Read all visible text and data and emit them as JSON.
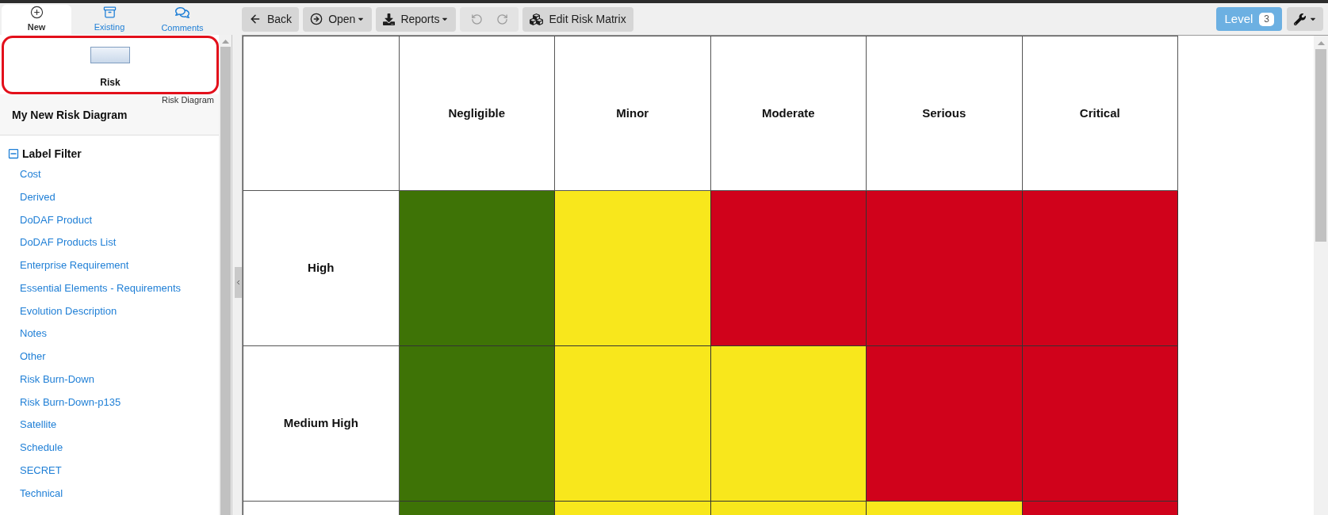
{
  "sidebar": {
    "tabs": [
      {
        "label": "New",
        "kind": "new",
        "selected": true
      },
      {
        "label": "Existing",
        "kind": "existing",
        "selected": false
      },
      {
        "label": "Comments",
        "kind": "comments",
        "selected": false
      }
    ],
    "palette": {
      "items": [
        {
          "label": "Risk",
          "selected": true
        }
      ],
      "caption": "Risk Diagram"
    },
    "diagram_name": "My New Risk Diagram",
    "label_filter": {
      "title": "Label Filter",
      "expanded": true,
      "items": [
        "Cost",
        "Derived",
        "DoDAF Product",
        "DoDAF Products List",
        "Enterprise Requirement",
        "Essential Elements - Requirements",
        "Evolution Description",
        "Notes",
        "Other",
        "Risk Burn-Down",
        "Risk Burn-Down-p135",
        "Satellite",
        "Schedule",
        "SECRET",
        "Technical"
      ]
    }
  },
  "toolbar": {
    "buttons": [
      {
        "kind": "back",
        "label": "Back",
        "dropdown": false
      },
      {
        "kind": "open",
        "label": "Open",
        "dropdown": true
      },
      {
        "kind": "reports",
        "label": "Reports",
        "dropdown": true
      },
      {
        "kind": "history",
        "items": [
          {
            "kind": "undo",
            "disabled": true
          },
          {
            "kind": "redo",
            "disabled": true
          }
        ]
      },
      {
        "kind": "matrix",
        "label": "Edit Risk Matrix",
        "dropdown": false
      }
    ],
    "level": {
      "label": "Level",
      "badge": "3"
    },
    "tools_menu": {
      "dropdown": true
    }
  },
  "matrix": {
    "columns": [
      "Negligible",
      "Minor",
      "Moderate",
      "Serious",
      "Critical"
    ],
    "rows": [
      {
        "label": "High",
        "cells": [
          {
            "color": "#3e7306"
          },
          {
            "color": "#f8e71c"
          },
          {
            "color": "#d0021b"
          },
          {
            "color": "#d0021b"
          },
          {
            "color": "#d0021b"
          }
        ]
      },
      {
        "label": "Medium High",
        "cells": [
          {
            "color": "#3e7306"
          },
          {
            "color": "#f8e71c"
          },
          {
            "color": "#f8e71c"
          },
          {
            "color": "#d0021b"
          },
          {
            "color": "#d0021b"
          }
        ]
      },
      {
        "cells": [
          {
            "color": "#3e7306"
          },
          {
            "color": "#f8e71c"
          },
          {
            "color": "#f8e71c"
          },
          {
            "color": "#f8e71c"
          },
          {
            "color": "#d0021b"
          }
        ]
      }
    ]
  }
}
